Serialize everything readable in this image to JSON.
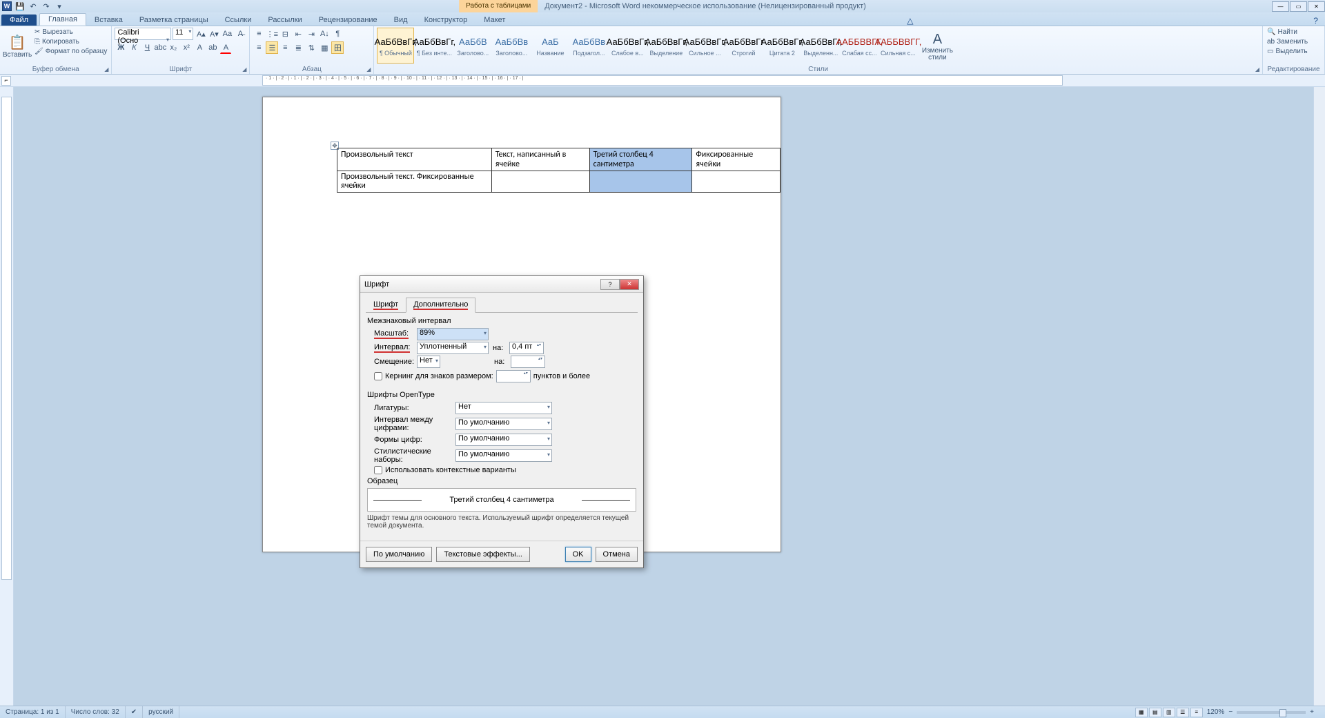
{
  "titlebar": {
    "table_tools": "Работа с таблицами",
    "doc_title": "Документ2 - Microsoft Word некоммерческое использование (Нелицензированный продукт)"
  },
  "tabs": {
    "file": "Файл",
    "home": "Главная",
    "insert": "Вставка",
    "pagelayout": "Разметка страницы",
    "references": "Ссылки",
    "mailings": "Рассылки",
    "review": "Рецензирование",
    "view": "Вид",
    "design": "Конструктор",
    "layout": "Макет"
  },
  "ribbon": {
    "clipboard": {
      "title": "Буфер обмена",
      "paste": "Вставить",
      "cut": "Вырезать",
      "copy": "Копировать",
      "fmt": "Формат по образцу"
    },
    "font": {
      "title": "Шрифт",
      "name": "Calibri (Осно",
      "size": "11"
    },
    "para": {
      "title": "Абзац"
    },
    "styles": {
      "title": "Стили",
      "items": [
        {
          "samp": "АаБбВвГг,",
          "name": "¶ Обычный"
        },
        {
          "samp": "АаБбВвГг,",
          "name": "¶ Без инте..."
        },
        {
          "samp": "АаБбВ",
          "name": "Заголово..."
        },
        {
          "samp": "АаБбВв",
          "name": "Заголово..."
        },
        {
          "samp": "АаБ",
          "name": "Название"
        },
        {
          "samp": "АаБбВв",
          "name": "Подзагол..."
        },
        {
          "samp": "АаБбВвГг,",
          "name": "Слабое в..."
        },
        {
          "samp": "АаБбВвГг,",
          "name": "Выделение"
        },
        {
          "samp": "АаБбВвГг,",
          "name": "Сильное ..."
        },
        {
          "samp": "АаБбВвГг",
          "name": "Строгий"
        },
        {
          "samp": "АаБбВвГг,",
          "name": "Цитата 2"
        },
        {
          "samp": "АаБбВвГг,",
          "name": "Выделенн..."
        },
        {
          "samp": "ААББВВГГ,",
          "name": "Слабая сс..."
        },
        {
          "samp": "ААББВВГГ,",
          "name": "Сильная с..."
        }
      ],
      "change": "Изменить стили"
    },
    "editing": {
      "title": "Редактирование",
      "find": "Найти",
      "replace": "Заменить",
      "select": "Выделить"
    }
  },
  "ruler": "· 1 · | · 2 · | · 1 · | · 2 · | · 3 · | · 4 · | · 5 · | · 6 · | · 7 · | · 8 · | · 9 · | · 10 · | · 11 · | · 12 · | · 13 · | · 14 · | · 15 · | · 16 · | · 17 · |",
  "table": {
    "r1c1": "Произвольный текст",
    "r1c2": "Текст,  написанный  в ячейке",
    "r1c3": "Третий  столбец  4 сантиметра",
    "r1c4": "Фиксированные ячейки",
    "r2c1": "Произвольный текст. Фиксированные ячейки"
  },
  "dialog": {
    "title": "Шрифт",
    "tab_font": "Шрифт",
    "tab_adv": "Дополнительно",
    "sec_spacing": "Межзнаковый интервал",
    "lbl_scale": "Масштаб:",
    "val_scale": "89%",
    "lbl_spacing": "Интервал:",
    "val_spacing": "Уплотненный",
    "lbl_na": "на:",
    "val_na": "0,4 пт",
    "lbl_pos": "Смещение:",
    "val_pos": "Нет",
    "lbl_na2": "на:",
    "chk_kern": "Кернинг для знаков размером:",
    "kern_suffix": "пунктов и более",
    "sec_ot": "Шрифты OpenType",
    "lbl_lig": "Лигатуры:",
    "val_lig": "Нет",
    "lbl_numspace": "Интервал между цифрами:",
    "val_numspace": "По умолчанию",
    "lbl_numform": "Формы цифр:",
    "val_numform": "По умолчанию",
    "lbl_styset": "Стилистические наборы:",
    "val_styset": "По умолчанию",
    "chk_ctx": "Использовать контекстные варианты",
    "sec_sample": "Образец",
    "sample_text": "Третий столбец 4 сантиметра",
    "desc": "Шрифт темы для основного текста. Используемый шрифт определяется текущей темой документа.",
    "btn_default": "По умолчанию",
    "btn_fx": "Текстовые эффекты...",
    "btn_ok": "OK",
    "btn_cancel": "Отмена"
  },
  "status": {
    "page": "Страница: 1 из 1",
    "words": "Число слов: 32",
    "lang": "русский",
    "zoom": "120%"
  }
}
